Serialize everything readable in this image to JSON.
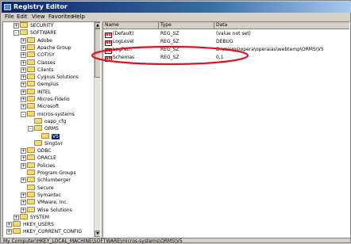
{
  "window": {
    "title": "Registry Editor"
  },
  "menu": [
    "File",
    "Edit",
    "View",
    "Favorites",
    "Help"
  ],
  "tree": {
    "items": [
      {
        "label": "SECURITY",
        "depth": 2,
        "expander": "+"
      },
      {
        "label": "SOFTWARE",
        "depth": 2,
        "expander": "-"
      },
      {
        "label": "Adobe",
        "depth": 3,
        "expander": "+"
      },
      {
        "label": "Apache Group",
        "depth": 3,
        "expander": "+"
      },
      {
        "label": "COTISY",
        "depth": 3,
        "expander": "+"
      },
      {
        "label": "Classes",
        "depth": 3,
        "expander": "+"
      },
      {
        "label": "Clients",
        "depth": 3,
        "expander": "+"
      },
      {
        "label": "Cygnus Solutions",
        "depth": 3,
        "expander": "+"
      },
      {
        "label": "Gemplus",
        "depth": 3,
        "expander": "+"
      },
      {
        "label": "INTEL",
        "depth": 3,
        "expander": "+"
      },
      {
        "label": "Micros-Fidelio",
        "depth": 3,
        "expander": "+"
      },
      {
        "label": "Microsoft",
        "depth": 3,
        "expander": "+"
      },
      {
        "label": "micros-systems",
        "depth": 3,
        "expander": "-"
      },
      {
        "label": "oapp_cfg",
        "depth": 4,
        "expander": ""
      },
      {
        "label": "ORMS",
        "depth": 4,
        "expander": "-"
      },
      {
        "label": "V5",
        "depth": 5,
        "expander": "",
        "selected": true
      },
      {
        "label": "SingSvr",
        "depth": 4,
        "expander": ""
      },
      {
        "label": "ODBC",
        "depth": 3,
        "expander": "+"
      },
      {
        "label": "ORACLE",
        "depth": 3,
        "expander": "+"
      },
      {
        "label": "Policies",
        "depth": 3,
        "expander": "+"
      },
      {
        "label": "Program Groups",
        "depth": 3,
        "expander": ""
      },
      {
        "label": "Schlumberger",
        "depth": 3,
        "expander": "+"
      },
      {
        "label": "Secure",
        "depth": 3,
        "expander": ""
      },
      {
        "label": "Symantec",
        "depth": 3,
        "expander": "+"
      },
      {
        "label": "VMware, Inc.",
        "depth": 3,
        "expander": "+"
      },
      {
        "label": "Wise Solutions",
        "depth": 3,
        "expander": "+"
      },
      {
        "label": "SYSTEM",
        "depth": 2,
        "expander": "+"
      },
      {
        "label": "HKEY_USERS",
        "depth": 1,
        "expander": "+"
      },
      {
        "label": "HKEY_CURRENT_CONFIG",
        "depth": 1,
        "expander": "+"
      }
    ]
  },
  "list": {
    "columns": [
      "Name",
      "Type",
      "Data"
    ],
    "rows": [
      {
        "name": "(Default)",
        "type": "REG_SZ",
        "data": "(value not set)"
      },
      {
        "name": "LogLevel",
        "type": "REG_SZ",
        "data": "DEBUG"
      },
      {
        "name": "LogPath",
        "type": "REG_SZ",
        "data": "D:\\micros\\opera\\operaias\\webtemp\\ORMS\\V5"
      },
      {
        "name": "Schemas",
        "type": "REG_SZ",
        "data": "0,1"
      }
    ]
  },
  "icons": {
    "value_icon": "ab",
    "expand": "+",
    "collapse": "-"
  },
  "colors": {
    "annotation": "#e0101e",
    "selection": "#0a246a"
  },
  "status": "My Computer\\HKEY_LOCAL_MACHINE\\SOFTWARE\\micros-systems\\ORMS\\V5"
}
